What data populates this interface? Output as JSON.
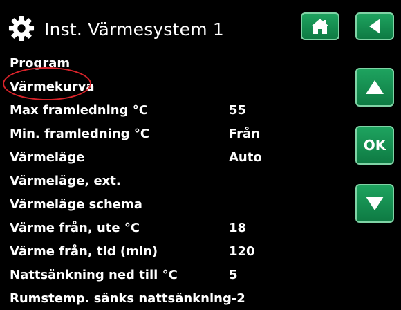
{
  "header": {
    "title": "Inst. Värmesystem 1",
    "icon": "gear-icon"
  },
  "buttons": {
    "home_icon": "home-icon",
    "back_icon": "back-arrow-icon",
    "up_icon": "up-arrow-icon",
    "ok_label": "OK",
    "down_icon": "down-arrow-icon",
    "accent_color": "#12904f"
  },
  "menu": {
    "items": [
      {
        "label": "Program",
        "value": ""
      },
      {
        "label": "Värmekurva",
        "value": ""
      },
      {
        "label": "Max framledning °C",
        "value": "55"
      },
      {
        "label": "Min. framledning °C",
        "value": "Från"
      },
      {
        "label": "Värmeläge",
        "value": "Auto"
      },
      {
        "label": "Värmeläge, ext.",
        "value": ""
      },
      {
        "label": "Värmeläge schema",
        "value": ""
      },
      {
        "label": "Värme från, ute °C",
        "value": "18"
      },
      {
        "label": "Värme från, tid (min)",
        "value": "120"
      },
      {
        "label": "Nattsänkning ned till °C",
        "value": "5"
      },
      {
        "label": "Rumstemp. sänks nattsänkning",
        "value": "-2"
      }
    ],
    "highlight_color": "#d8232a"
  }
}
